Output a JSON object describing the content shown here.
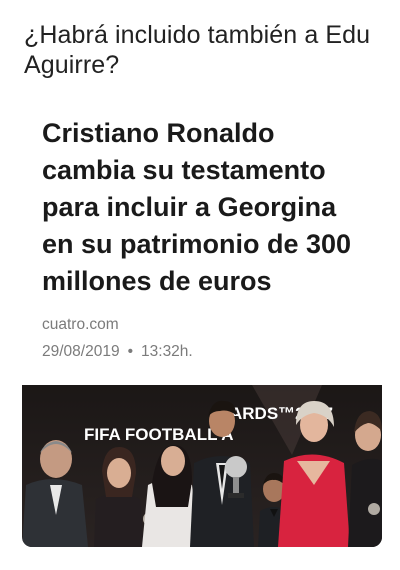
{
  "caption": "¿Habrá incluido también a Edu Aguirre?",
  "article": {
    "headline": "Cristiano Ronaldo cambia su testamento para incluir a Georgina en su patrimonio de 300 millones de euros",
    "source": "cuatro.com",
    "date": "29/08/2019",
    "separator": "•",
    "time": "13:32h.",
    "image": {
      "backdrop_text_left": "FIFA FOOTBALL A",
      "backdrop_text_right": "ARDS™2017"
    }
  }
}
